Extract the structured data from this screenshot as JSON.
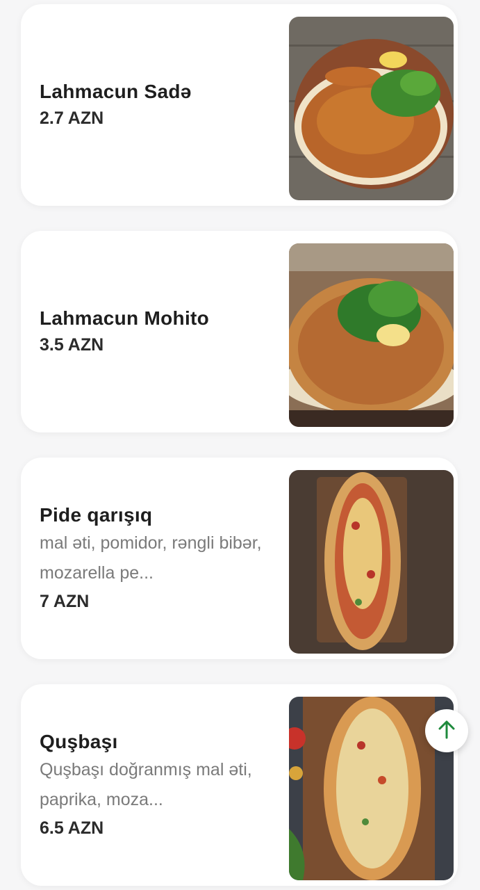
{
  "menu": {
    "items": [
      {
        "name": "Lahmacun Sadə",
        "description": "",
        "price": "2.7 AZN"
      },
      {
        "name": "Lahmacun Mohito",
        "description": "",
        "price": "3.5 AZN"
      },
      {
        "name": "Pide qarışıq",
        "description": "mal əti, pomidor, rəngli bibər, mozarella pe...",
        "price": "7 AZN"
      },
      {
        "name": "Quşbaşı",
        "description": "Quşbaşı doğranmış mal əti, paprika, moza...",
        "price": "6.5 AZN"
      }
    ]
  },
  "scroll_top_icon": "arrow-up-icon",
  "colors": {
    "accent": "#1e8a3c",
    "background": "#f6f6f7",
    "card": "#ffffff"
  }
}
